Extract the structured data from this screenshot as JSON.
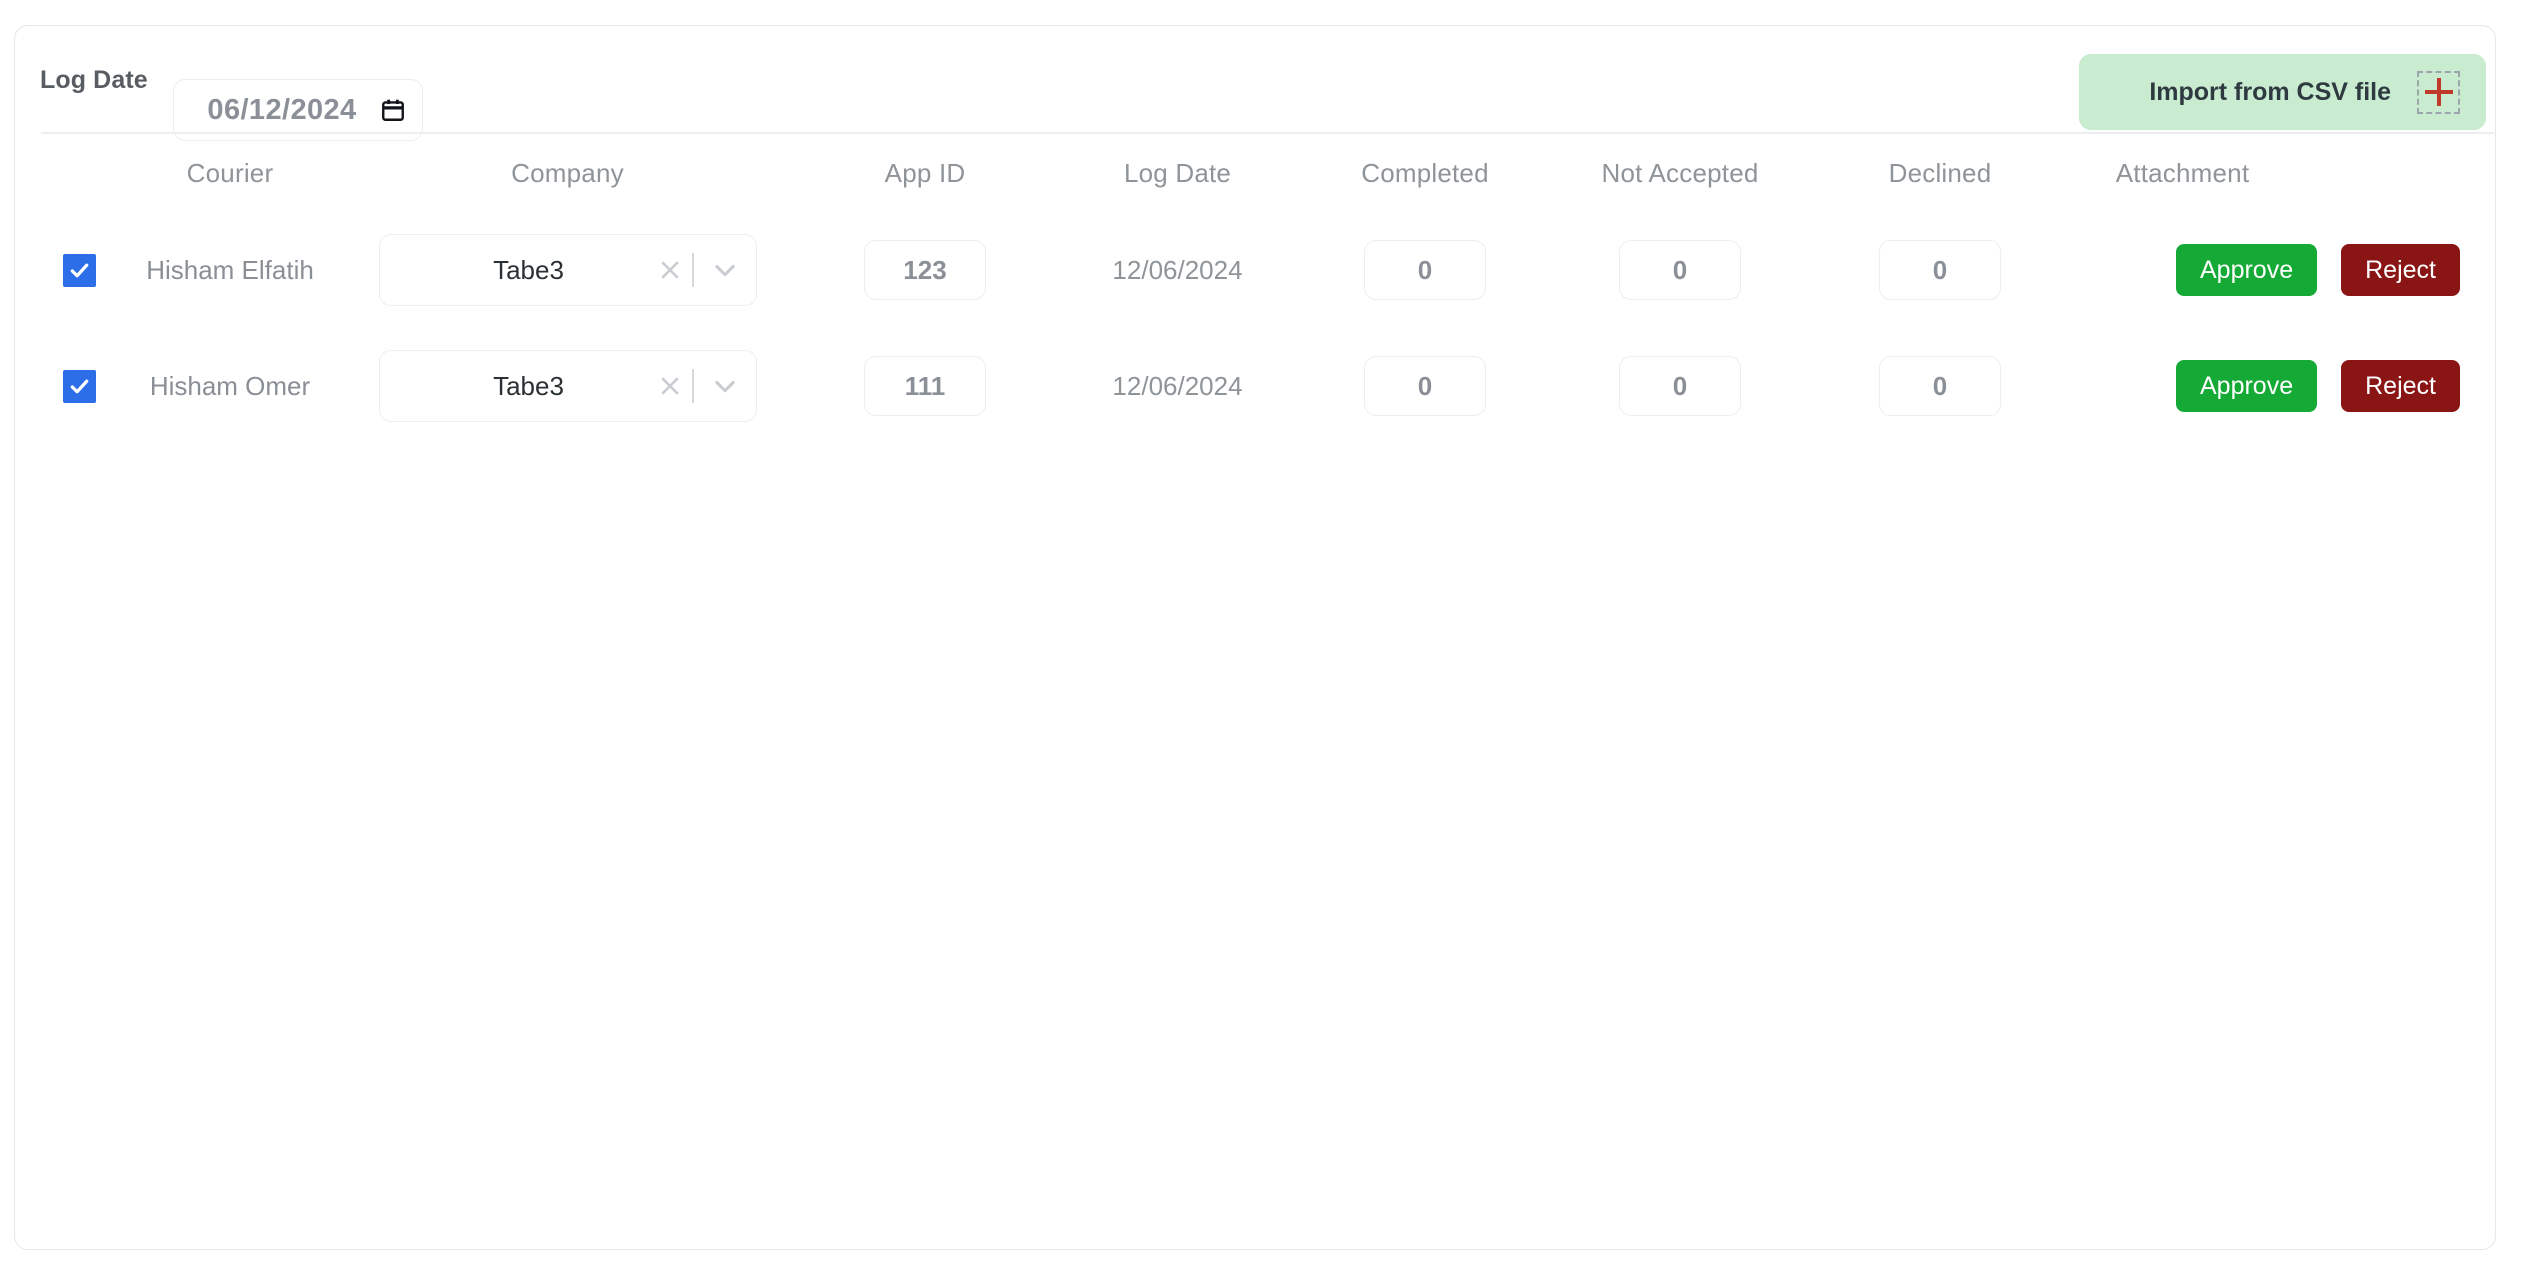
{
  "toolbar": {
    "log_date_label": "Log Date",
    "log_date_value": "06/12/2024",
    "calendar_icon": "calendar-icon",
    "import_label": "Import from CSV file",
    "import_icon": "plus-icon",
    "import_bg_color": "#c9ecd1",
    "import_icon_color": "#c0392b"
  },
  "table": {
    "columns": [
      "Courier",
      "Company",
      "App ID",
      "Log Date",
      "Completed",
      "Not Accepted",
      "Declined",
      "Attachment"
    ],
    "rows": [
      {
        "selected": true,
        "courier": "Hisham Elfatih",
        "company": "Tabe3",
        "app_id": "123",
        "log_date": "12/06/2024",
        "completed": "0",
        "not_accepted": "0",
        "declined": "0",
        "attachment": "",
        "approve_label": "Approve",
        "reject_label": "Reject"
      },
      {
        "selected": true,
        "courier": "Hisham Omer",
        "company": "Tabe3",
        "app_id": "111",
        "log_date": "12/06/2024",
        "completed": "0",
        "not_accepted": "0",
        "declined": "0",
        "attachment": "",
        "approve_label": "Approve",
        "reject_label": "Reject"
      }
    ]
  },
  "colors": {
    "approve": "#15a935",
    "reject": "#8a1515",
    "checkbox": "#2b6ee8",
    "header_text": "#8f9499"
  }
}
